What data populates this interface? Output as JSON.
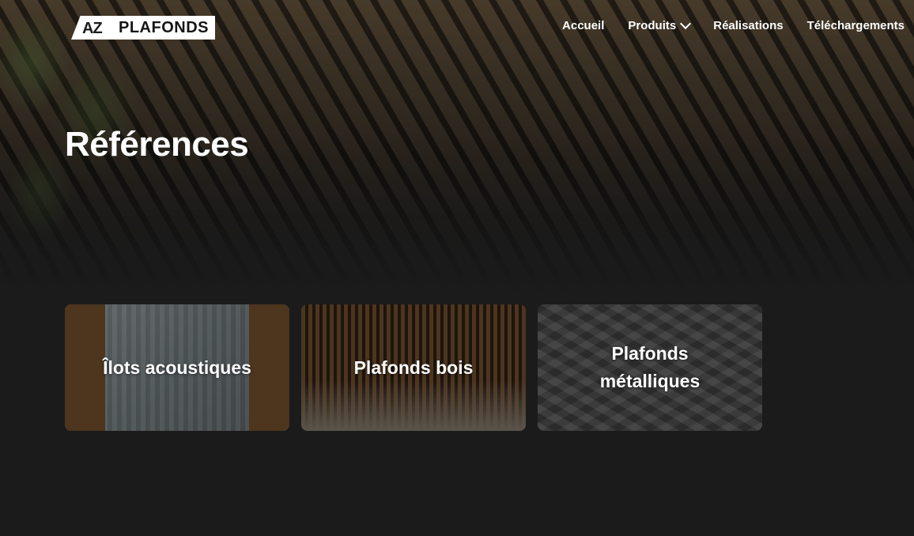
{
  "header": {
    "logo_mark": "AZ",
    "logo_text": "PLAFONDS",
    "nav": [
      {
        "label": "Accueil"
      },
      {
        "label": "Produits",
        "has_dropdown": true
      },
      {
        "label": "Réalisations"
      },
      {
        "label": "Téléchargements"
      }
    ]
  },
  "hero": {
    "title": "Références"
  },
  "cards": [
    {
      "label": "Îlots acoustiques"
    },
    {
      "label": "Plafonds bois"
    },
    {
      "label": "Plafonds métalliques"
    }
  ],
  "colors": {
    "background": "#1b1b1b",
    "text": "#ffffff"
  }
}
